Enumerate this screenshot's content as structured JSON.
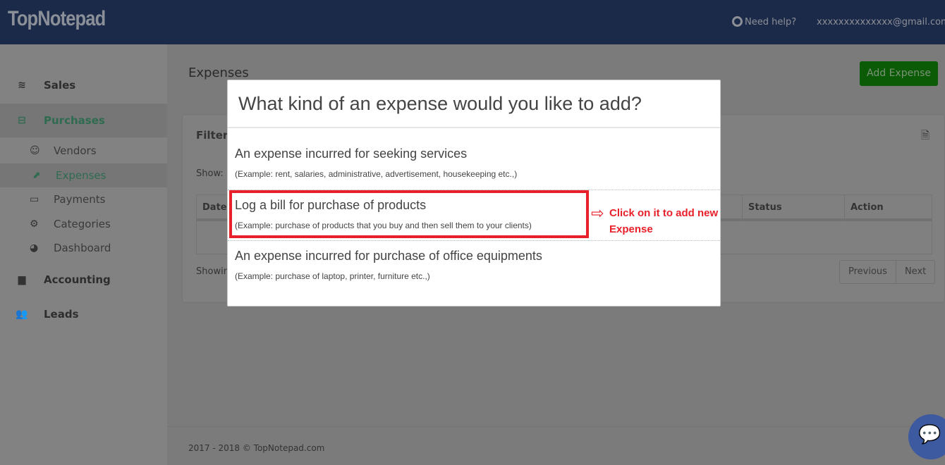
{
  "header": {
    "logo": "TopNotepad",
    "help": "Need help?",
    "user": "xxxxxxxxxxxxxx@gmail.com"
  },
  "sidebar": {
    "items": [
      {
        "label": "Sales",
        "icon": "layers-icon"
      },
      {
        "label": "Purchases",
        "icon": "minus-square-icon",
        "active": true
      },
      {
        "label": "Accounting",
        "icon": "bar-chart-icon"
      },
      {
        "label": "Leads",
        "icon": "users-icon"
      }
    ],
    "sub_items": [
      {
        "label": "Vendors",
        "icon": "user-icon"
      },
      {
        "label": "Expenses",
        "icon": "share-icon",
        "active": true
      },
      {
        "label": "Payments",
        "icon": "credit-card-icon"
      },
      {
        "label": "Categories",
        "icon": "gear-icon"
      },
      {
        "label": "Dashboard",
        "icon": "dashboard-icon"
      }
    ]
  },
  "main": {
    "title": "Expenses",
    "add_button": "Add Expense",
    "filter": "Filter",
    "show": "Show:",
    "showing": "Showin",
    "columns": [
      "Date",
      "Status",
      "Action"
    ],
    "previous": "Previous",
    "next": "Next"
  },
  "footer": "2017 - 2018 © TopNotepad.com",
  "modal": {
    "title": "What kind of an expense would you like to add?",
    "options": [
      {
        "title": "An expense incurred for seeking services",
        "desc": "(Example: rent, salaries, administrative, advertisement, housekeeping etc.,)"
      },
      {
        "title": "Log a bill for purchase of products",
        "desc": "(Example: purchase of products that you buy and then sell them to your clients)"
      },
      {
        "title": "An expense incurred for purchase of office equipments",
        "desc": "(Example: purchase of laptop, printer, furniture etc.,)"
      }
    ]
  },
  "annotation": {
    "line1": "Click on it to add new",
    "line2": "Expense",
    "color": "#e8202a"
  }
}
